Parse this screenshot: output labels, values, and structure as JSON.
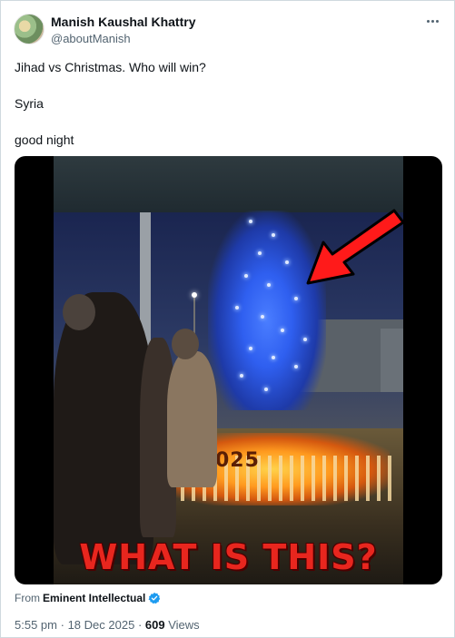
{
  "author": {
    "name": "Manish Kaushal Khattry",
    "handle": "@aboutManish"
  },
  "tweet": {
    "lines": [
      "Jihad vs Christmas. Who will win?",
      "Syria",
      "good night"
    ]
  },
  "media": {
    "caption": "WHAT IS THIS?",
    "sign_text": "025",
    "caption_color": "#e8261e",
    "arrow_color": "#ff1a1a"
  },
  "source": {
    "prefix": "From",
    "name": "Eminent Intellectual",
    "badge_color": "#1d9bf0"
  },
  "meta": {
    "time": "5:55 pm",
    "sep1": "·",
    "date": "18 Dec 2025",
    "sep2": "·",
    "views_count": "609",
    "views_label": "Views"
  },
  "icons": {
    "more": "more-horizontal-icon",
    "verified": "verified-badge-icon"
  }
}
